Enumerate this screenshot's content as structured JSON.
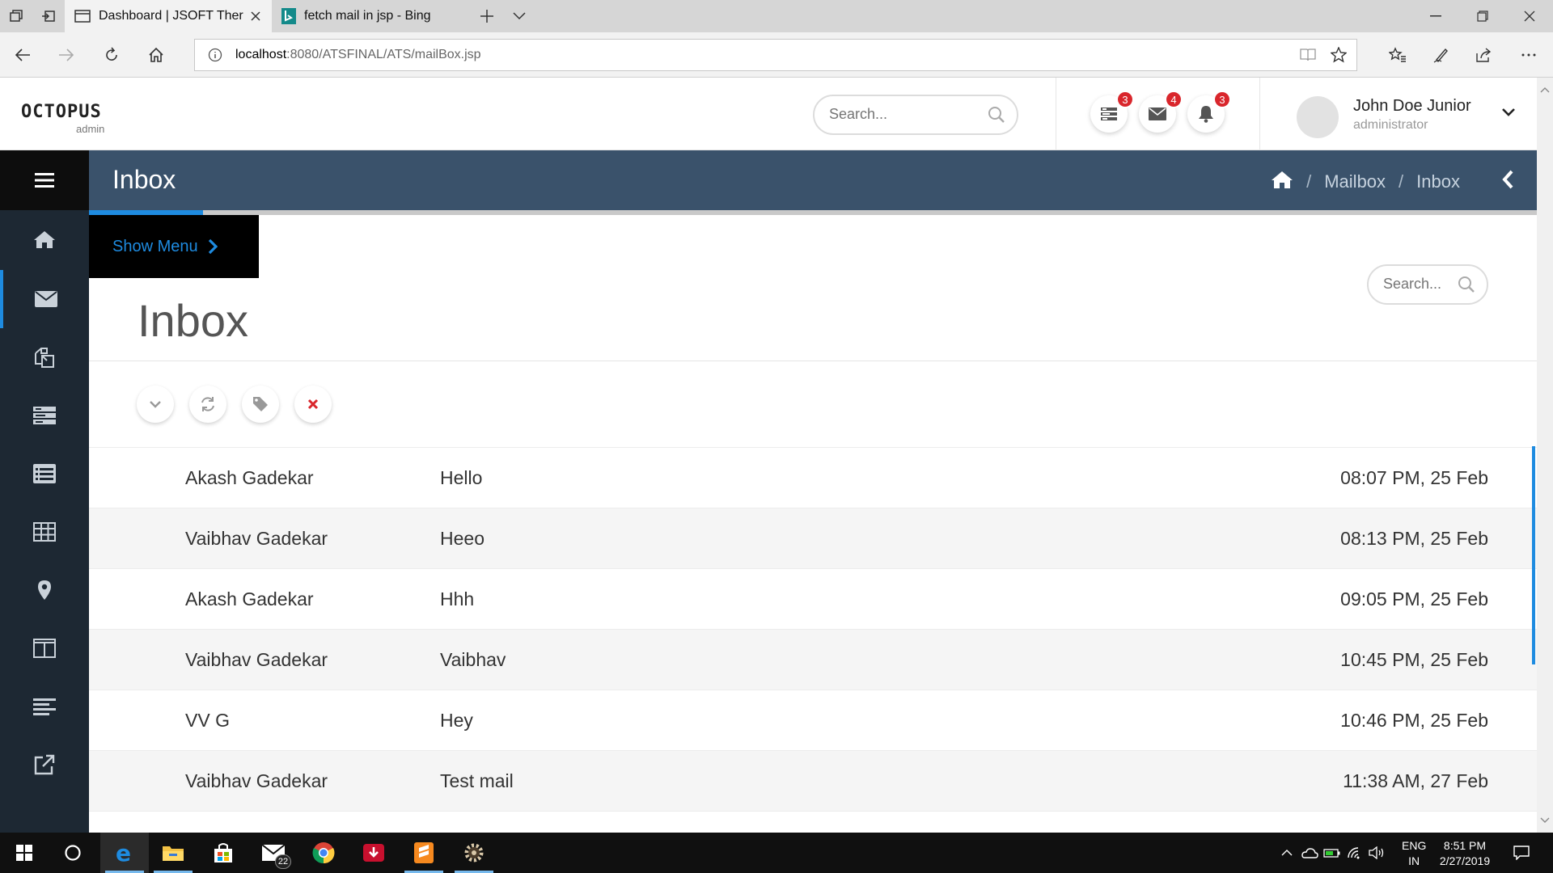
{
  "browser": {
    "tabs": [
      {
        "title": "Dashboard | JSOFT Ther",
        "active": true
      },
      {
        "title": "fetch mail in jsp - Bing",
        "active": false
      }
    ],
    "url_host": "localhost",
    "url_rest": ":8080/ATSFINAL/ATS/mailBox.jsp"
  },
  "header": {
    "logo": "OCTOPUS",
    "logo_sub": "admin",
    "search_placeholder": "Search...",
    "badges": {
      "tasks": "3",
      "messages": "4",
      "alerts": "3"
    },
    "user_name": "John Doe Junior",
    "user_role": "administrator"
  },
  "titlebar": {
    "title": "Inbox",
    "breadcrumb": [
      "Mailbox",
      "Inbox"
    ]
  },
  "content": {
    "show_menu": "Show Menu",
    "search_placeholder": "Search...",
    "heading": "Inbox",
    "mails": [
      {
        "from": "Akash Gadekar",
        "subject": "Hello",
        "date": "08:07 PM, 25 Feb"
      },
      {
        "from": "Vaibhav Gadekar",
        "subject": "Heeo",
        "date": "08:13 PM, 25 Feb"
      },
      {
        "from": "Akash Gadekar",
        "subject": "Hhh",
        "date": "09:05 PM, 25 Feb"
      },
      {
        "from": "Vaibhav Gadekar",
        "subject": "Vaibhav",
        "date": "10:45 PM, 25 Feb"
      },
      {
        "from": "VV G",
        "subject": "Hey",
        "date": "10:46 PM, 25 Feb"
      },
      {
        "from": "Vaibhav Gadekar",
        "subject": "Test mail",
        "date": "11:38 AM, 27 Feb"
      }
    ]
  },
  "taskbar": {
    "mail_count": "22",
    "lang_top": "ENG",
    "lang_bottom": "IN",
    "time": "8:51 PM",
    "date": "2/27/2019"
  },
  "colors": {
    "accent": "#1e8be0",
    "sidebar": "#1d2833",
    "titlebar": "#3a526b",
    "badge": "#d9262c"
  }
}
